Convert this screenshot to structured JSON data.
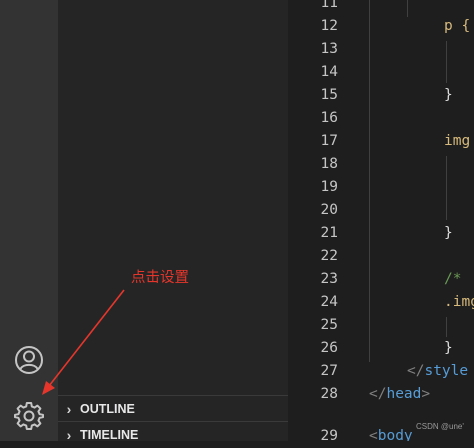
{
  "sidebar_sections": {
    "outline": "OUTLINE",
    "timeline": "TIMELINE"
  },
  "line_numbers": [
    "11",
    "12",
    "13",
    "14",
    "15",
    "16",
    "17",
    "18",
    "19",
    "20",
    "21",
    "22",
    "23",
    "24",
    "25",
    "26",
    "27",
    "28",
    "29"
  ],
  "code": {
    "l12": "p {",
    "l15": "}",
    "l17": "img",
    "l21": "}",
    "l23": "/* ",
    "l24": ".img",
    "l26": "}",
    "l27_open": "</",
    "l27_tag": "style",
    "l28_open": "</",
    "l28_tag": "head",
    "l28_close": ">",
    "l29_open": "<",
    "l29_tag": "body"
  },
  "annotation": {
    "text": "点击设置",
    "color": "#e6362b"
  },
  "watermark": "CSDN @une'",
  "icons": {
    "account": "account-icon",
    "settings": "gear-icon"
  },
  "colors": {
    "activity_bar": "#333333",
    "sidebar": "#252526",
    "editor": "#1e1e1e",
    "selector": "#d7ba7d",
    "tag": "#569cd6",
    "comment": "#6a9955"
  }
}
